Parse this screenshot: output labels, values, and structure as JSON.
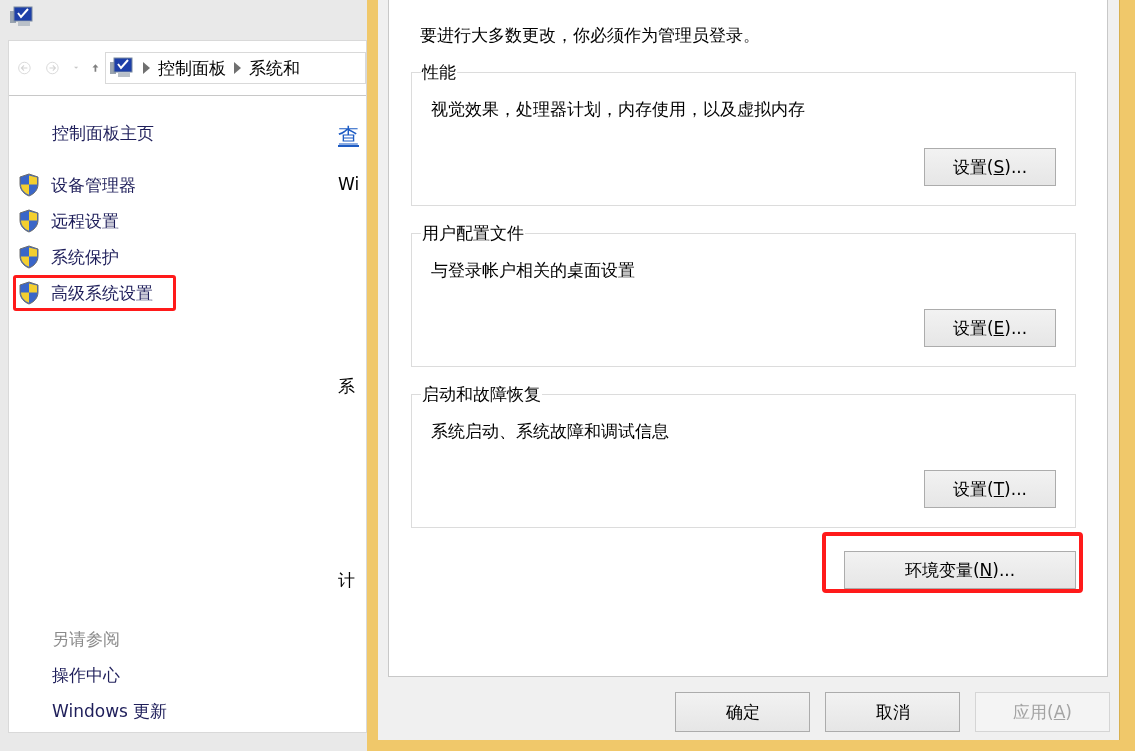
{
  "background_window": {
    "breadcrumb": [
      "控制面板",
      "系统和"
    ],
    "sidebar": {
      "home": "控制面板主页",
      "tasks": [
        {
          "label": "设备管理器",
          "highlighted": false
        },
        {
          "label": "远程设置",
          "highlighted": false
        },
        {
          "label": "系统保护",
          "highlighted": false
        },
        {
          "label": "高级系统设置",
          "highlighted": true
        }
      ],
      "see_also": {
        "heading": "另请参阅",
        "links": [
          "操作中心",
          "Windows 更新"
        ]
      }
    },
    "content_fragments": [
      {
        "text": "查",
        "kind": "heading"
      },
      {
        "text": "Wi",
        "kind": "text"
      },
      {
        "text": "系",
        "kind": "text"
      },
      {
        "text": "计",
        "kind": "text"
      }
    ]
  },
  "dialog": {
    "notice": "要进行大多数更改，你必须作为管理员登录。",
    "groups": [
      {
        "title": "性能",
        "description": "视觉效果，处理器计划，内存使用，以及虚拟内存",
        "button": {
          "before": "设置(",
          "key": "S",
          "after": ")..."
        }
      },
      {
        "title": "用户配置文件",
        "description": "与登录帐户相关的桌面设置",
        "button": {
          "before": "设置(",
          "key": "E",
          "after": ")..."
        }
      },
      {
        "title": "启动和故障恢复",
        "description": "系统启动、系统故障和调试信息",
        "button": {
          "before": "设置(",
          "key": "T",
          "after": ")..."
        }
      }
    ],
    "env_button": {
      "before": "环境变量(",
      "key": "N",
      "after": ")...",
      "highlighted": true
    },
    "buttons": [
      {
        "before": "确定",
        "disabled": false
      },
      {
        "before": "取消",
        "disabled": false
      },
      {
        "before": "应用(",
        "key": "A",
        "after": ")",
        "disabled": true
      }
    ]
  }
}
